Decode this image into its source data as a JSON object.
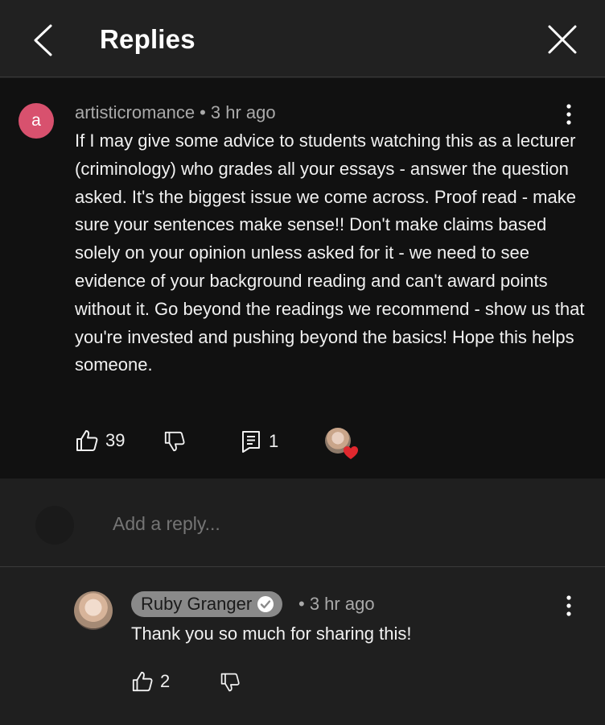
{
  "header": {
    "title": "Replies",
    "back_icon": "chevron-left-icon",
    "close_icon": "close-icon"
  },
  "comment": {
    "avatar_letter": "a",
    "avatar_color": "#d8516e",
    "author": "artisticromance",
    "separator": "•",
    "time": "3 hr ago",
    "text": "If I may give some advice to students watching this as a lecturer (criminology) who grades all your essays - answer the question asked. It's the biggest issue we come across. Proof read - make sure your sentences make sense!! Don't make claims based solely on your opinion unless asked for it - we need to see evidence of your background reading and can't award points without it. Go beyond the readings we recommend - show us that you're invested and pushing beyond the basics! Hope this helps someone.",
    "likes": "39",
    "replies": "1",
    "heart_color": "#e0282e"
  },
  "reply_box": {
    "placeholder": "Add a reply..."
  },
  "reply": {
    "author": "Ruby Granger",
    "separator": "•",
    "time": "3 hr ago",
    "text": "Thank you so much for sharing this!",
    "likes": "2"
  }
}
